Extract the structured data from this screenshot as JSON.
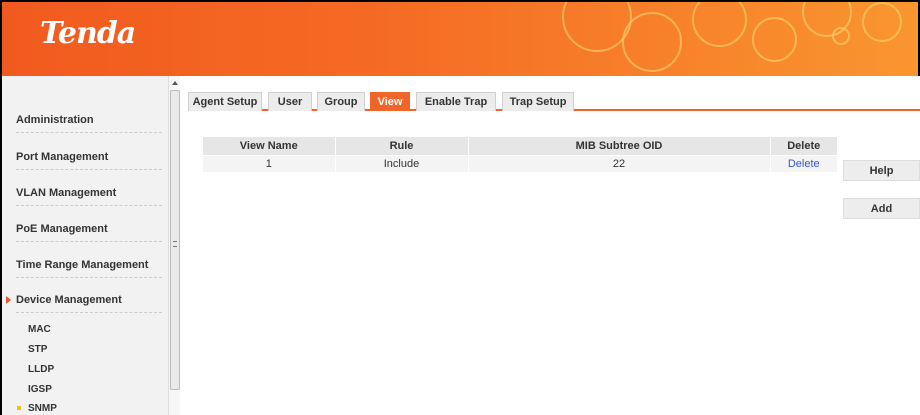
{
  "header": {
    "logo": "Tenda",
    "accent_color": "#f0652a"
  },
  "sidebar": {
    "items": [
      {
        "label": "Administration"
      },
      {
        "label": "Port Management"
      },
      {
        "label": "VLAN Management"
      },
      {
        "label": "PoE Management"
      },
      {
        "label": "Time Range Management"
      },
      {
        "label": "Device Management",
        "active": true
      }
    ],
    "sub_items": [
      {
        "label": "MAC"
      },
      {
        "label": "STP"
      },
      {
        "label": "LLDP"
      },
      {
        "label": "IGSP"
      },
      {
        "label": "SNMP",
        "active": true
      }
    ]
  },
  "tabs": [
    {
      "label": "Agent Setup"
    },
    {
      "label": "User"
    },
    {
      "label": "Group"
    },
    {
      "label": "View",
      "active": true
    },
    {
      "label": "Enable Trap"
    },
    {
      "label": "Trap Setup"
    }
  ],
  "table": {
    "headers": [
      "View Name",
      "Rule",
      "MIB Subtree OID",
      "Delete"
    ],
    "rows": [
      {
        "view_name": "1",
        "rule": "Include",
        "oid": "22",
        "delete": "Delete"
      }
    ]
  },
  "buttons": {
    "help": "Help",
    "add": "Add"
  }
}
